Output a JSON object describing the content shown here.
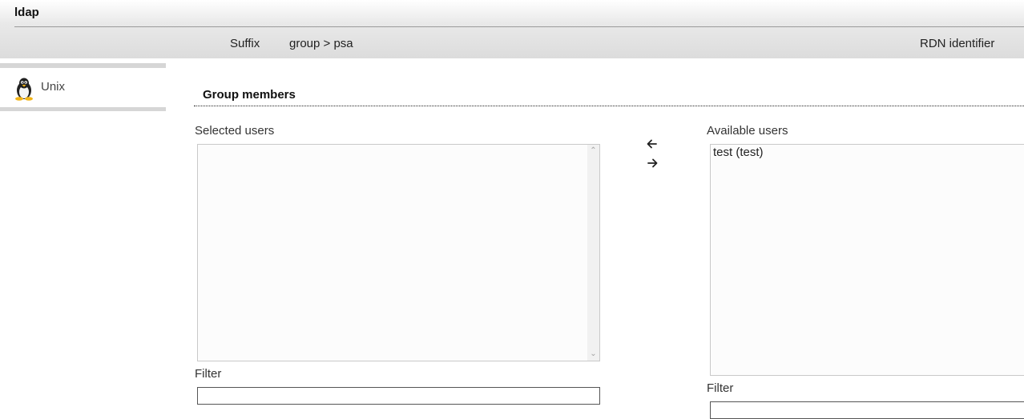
{
  "header": {
    "app_title": "ldap",
    "suffix_label": "Suffix",
    "suffix_value": "group > psa",
    "rdn_label": "RDN identifier"
  },
  "tabs": [
    {
      "label": "Unix",
      "icon": "linux-penguin-icon"
    }
  ],
  "section": {
    "title": "Group members"
  },
  "selected_users": {
    "label": "Selected users",
    "items": [],
    "filter_label": "Filter",
    "filter_value": ""
  },
  "available_users": {
    "label": "Available users",
    "items": [
      "test (test)"
    ],
    "filter_label": "Filter",
    "filter_value": ""
  },
  "controls": {
    "move_left_icon": "arrow-left-icon",
    "move_right_icon": "arrow-right-icon"
  }
}
